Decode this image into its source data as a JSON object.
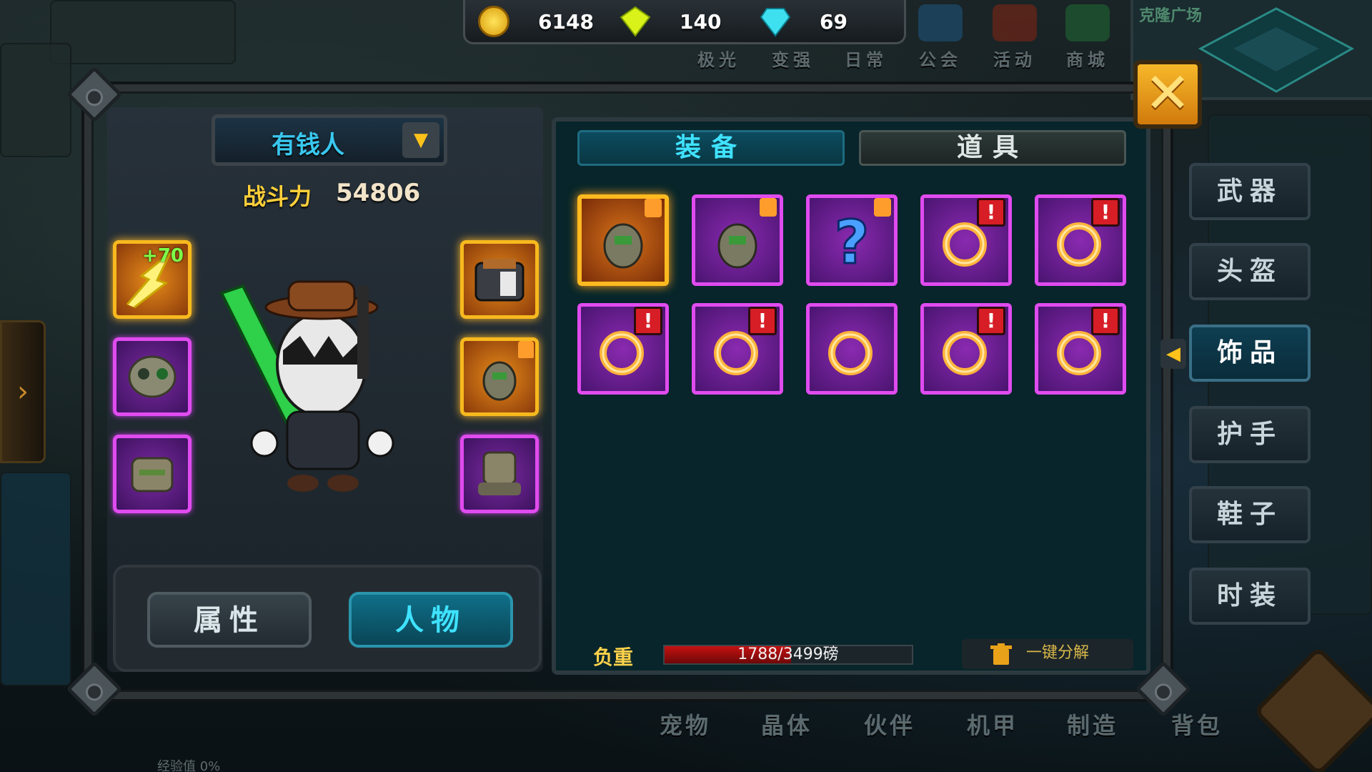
{
  "currency": {
    "gold": "6148",
    "gem_yellow": "140",
    "gem_blue": "69"
  },
  "top_menu": [
    {
      "label": "极光",
      "icon": "aurora-icon"
    },
    {
      "label": "变强",
      "icon": "powerup-icon"
    },
    {
      "label": "日常",
      "icon": "daily-icon"
    },
    {
      "label": "公会",
      "icon": "guild-fist-icon"
    },
    {
      "label": "活动",
      "icon": "event-gift-icon"
    },
    {
      "label": "商城",
      "icon": "shop-basket-icon"
    }
  ],
  "minimap": {
    "title": "克隆广场"
  },
  "character": {
    "name": "有钱人",
    "power_label": "战斗力",
    "power_value": "54806",
    "weapon_bonus": "+70"
  },
  "character_tabs": {
    "attributes": "属性",
    "character": "人物"
  },
  "inventory_tabs": {
    "equipment": "装备",
    "items": "道具"
  },
  "inventory_alert": "!",
  "weight": {
    "label": "负重",
    "text": "1788/3499磅",
    "current": 1788,
    "max": 3499
  },
  "dismantle_label": "一键分解",
  "categories": [
    "武器",
    "头盔",
    "饰品",
    "护手",
    "鞋子",
    "时装"
  ],
  "active_category": "饰品",
  "bottom_menu": [
    "宠物",
    "晶体",
    "伙伴",
    "机甲",
    "制造",
    "背包"
  ],
  "exp_label": "经验值 0%",
  "colors": {
    "gold_rarity": "#f7b91e",
    "purple_rarity": "#e04bef",
    "accent_cyan": "#3fe2ff",
    "close_orange": "#f7b82a"
  }
}
